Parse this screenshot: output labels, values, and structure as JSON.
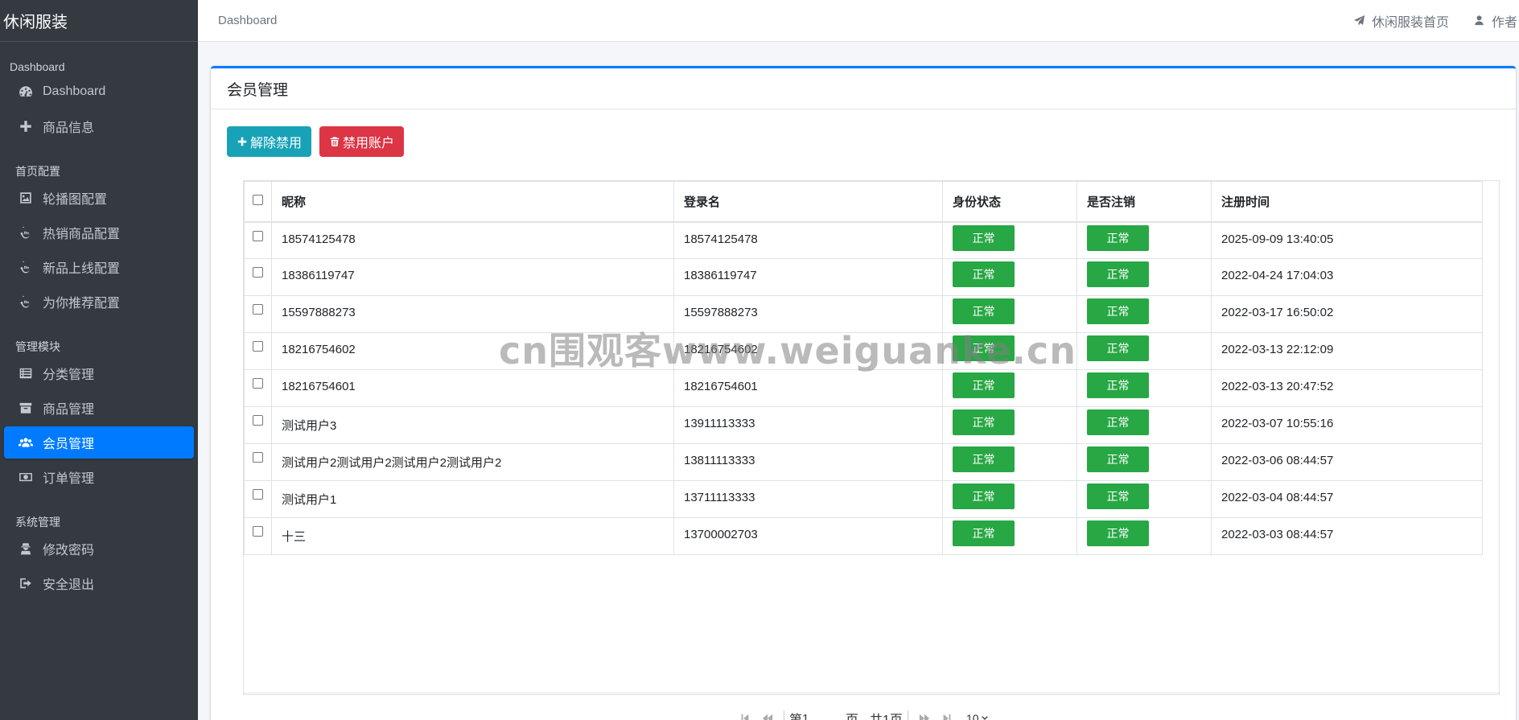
{
  "brand": "休闲服装",
  "sidebar": {
    "sections": [
      {
        "header": "Dashboard",
        "items": [
          {
            "label": "Dashboard",
            "icon": "dashboard-icon"
          },
          {
            "label": "商品信息",
            "icon": "plus-icon"
          }
        ]
      },
      {
        "header": "首页配置",
        "items": [
          {
            "label": "轮播图配置",
            "icon": "image-icon"
          },
          {
            "label": "热销商品配置",
            "icon": "hand-pointer-icon"
          },
          {
            "label": "新品上线配置",
            "icon": "hand-pointer-icon"
          },
          {
            "label": "为你推荐配置",
            "icon": "hand-pointer-icon"
          }
        ]
      },
      {
        "header": "管理模块",
        "items": [
          {
            "label": "分类管理",
            "icon": "list-icon"
          },
          {
            "label": "商品管理",
            "icon": "archive-icon"
          },
          {
            "label": "会员管理",
            "icon": "users-icon",
            "active": true
          },
          {
            "label": "订单管理",
            "icon": "money-icon"
          }
        ]
      },
      {
        "header": "系统管理",
        "items": [
          {
            "label": "修改密码",
            "icon": "user-secret-icon"
          },
          {
            "label": "安全退出",
            "icon": "sign-out-icon"
          }
        ]
      }
    ]
  },
  "topbar": {
    "breadcrumb": "Dashboard",
    "home_link": "休闲服装首页",
    "author_link": "作者"
  },
  "card": {
    "title": "会员管理",
    "unban_button": "解除禁用",
    "ban_button": "禁用账户"
  },
  "table": {
    "columns": [
      "昵称",
      "登录名",
      "身份状态",
      "是否注销",
      "注册时间"
    ],
    "rows": [
      {
        "nickname": "18574125478",
        "login": "18574125478",
        "status": "正常",
        "deleted": "正常",
        "time": "2025-09-09 13:40:05"
      },
      {
        "nickname": "18386119747",
        "login": "18386119747",
        "status": "正常",
        "deleted": "正常",
        "time": "2022-04-24 17:04:03"
      },
      {
        "nickname": "15597888273",
        "login": "15597888273",
        "status": "正常",
        "deleted": "正常",
        "time": "2022-03-17 16:50:02"
      },
      {
        "nickname": "18216754602",
        "login": "18216754602",
        "status": "正常",
        "deleted": "正常",
        "time": "2022-03-13 22:12:09"
      },
      {
        "nickname": "18216754601",
        "login": "18216754601",
        "status": "正常",
        "deleted": "正常",
        "time": "2022-03-13 20:47:52"
      },
      {
        "nickname": "测试用户3",
        "login": "13911113333",
        "status": "正常",
        "deleted": "正常",
        "time": "2022-03-07 10:55:16"
      },
      {
        "nickname": "测试用户2测试用户2测试用户2测试用户2",
        "login": "13811113333",
        "status": "正常",
        "deleted": "正常",
        "time": "2022-03-06 08:44:57"
      },
      {
        "nickname": "测试用户1",
        "login": "13711113333",
        "status": "正常",
        "deleted": "正常",
        "time": "2022-03-04 08:44:57"
      },
      {
        "nickname": "十三",
        "login": "13700002703",
        "status": "正常",
        "deleted": "正常",
        "time": "2022-03-03 08:44:57"
      }
    ]
  },
  "pager": {
    "page_prefix": "第",
    "page_value": "1",
    "page_suffix": "页",
    "total": "共1页",
    "page_size": "10"
  },
  "watermark": "cn围观客www.weiguanke.cn",
  "colors": {
    "primary": "#007bff",
    "info": "#17a2b8",
    "danger": "#dc3545",
    "success": "#28a745",
    "sidebar": "#343a40"
  }
}
